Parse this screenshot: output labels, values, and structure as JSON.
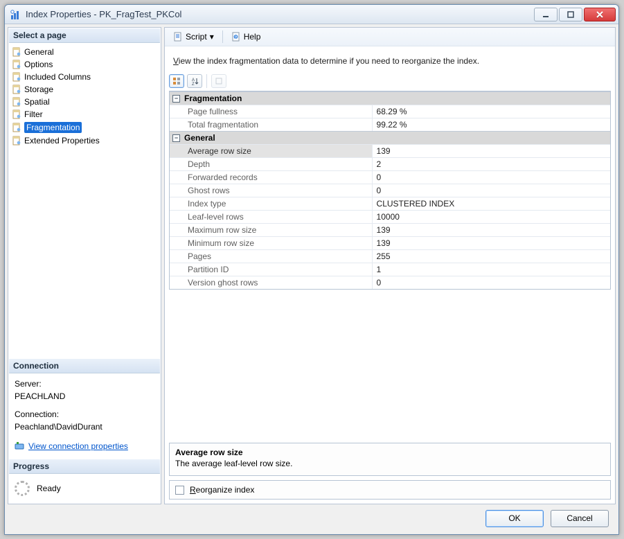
{
  "window": {
    "title": "Index Properties - PK_FragTest_PKCol"
  },
  "toolbar": {
    "script": "Script",
    "help": "Help"
  },
  "left": {
    "header": "Select a page",
    "pages": [
      {
        "label": "General",
        "icon": "page-icon"
      },
      {
        "label": "Options",
        "icon": "page-icon"
      },
      {
        "label": "Included Columns",
        "icon": "page-icon"
      },
      {
        "label": "Storage",
        "icon": "page-icon"
      },
      {
        "label": "Spatial",
        "icon": "page-icon"
      },
      {
        "label": "Filter",
        "icon": "page-icon"
      },
      {
        "label": "Fragmentation",
        "icon": "page-icon",
        "selected": true
      },
      {
        "label": "Extended Properties",
        "icon": "page-icon"
      }
    ],
    "connection_header": "Connection",
    "server_label": "Server:",
    "server_value": "PEACHLAND",
    "connection_label": "Connection:",
    "connection_value": "Peachland\\DavidDurant",
    "view_conn_link": "View connection properties",
    "progress_header": "Progress",
    "progress_status": "Ready"
  },
  "content": {
    "intro_prefix": "V",
    "intro_rest": "iew the index fragmentation data to determine if you need to reorganize the index.",
    "sections": [
      {
        "title": "Fragmentation",
        "rows": [
          {
            "label": "Page fullness",
            "value": "68.29 %"
          },
          {
            "label": "Total fragmentation",
            "value": "99.22 %"
          }
        ]
      },
      {
        "title": "General",
        "rows": [
          {
            "label": "Average row size",
            "value": "139",
            "selected": true
          },
          {
            "label": "Depth",
            "value": "2"
          },
          {
            "label": "Forwarded records",
            "value": "0"
          },
          {
            "label": "Ghost rows",
            "value": "0"
          },
          {
            "label": "Index type",
            "value": "CLUSTERED INDEX"
          },
          {
            "label": "Leaf-level rows",
            "value": "10000"
          },
          {
            "label": "Maximum row size",
            "value": "139"
          },
          {
            "label": "Minimum row size",
            "value": "139"
          },
          {
            "label": "Pages",
            "value": "255"
          },
          {
            "label": "Partition ID",
            "value": "1"
          },
          {
            "label": "Version ghost rows",
            "value": "0"
          }
        ]
      }
    ],
    "desc_title": "Average row size",
    "desc_text": "The average leaf-level row size.",
    "reorg_prefix": "R",
    "reorg_rest": "eorganize index"
  },
  "footer": {
    "ok": "OK",
    "cancel": "Cancel"
  }
}
